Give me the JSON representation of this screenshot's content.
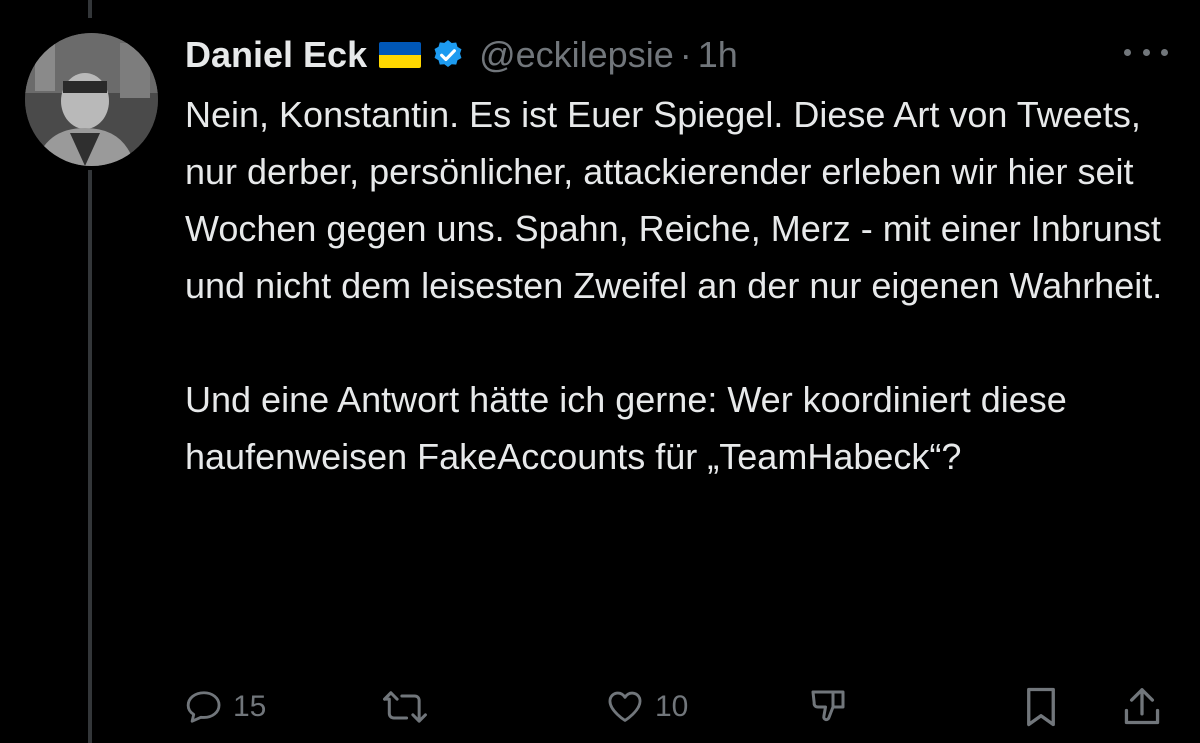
{
  "tweet": {
    "author_name": "Daniel Eck",
    "handle": "@eckilepsie",
    "separator": "·",
    "time": "1h",
    "body_paragraph_1": "Nein, Konstantin. Es ist Euer Spiegel. Diese Art von Tweets, nur derber, persönlicher, attackierender erleben wir hier seit Wochen gegen uns. Spahn, Reiche, Merz - mit einer Inbrunst und nicht dem leisesten Zweifel an der nur eigenen Wahrheit.",
    "body_paragraph_2": "Und eine Antwort hätte ich gerne: Wer koordiniert diese haufenweisen FakeAccounts für „TeamHabeck“?"
  },
  "actions": {
    "reply_count": "15",
    "like_count": "10"
  },
  "icons": {
    "avatar": "avatar",
    "flag": "ukraine-flag-icon",
    "verified": "verified-badge-icon",
    "more": "more-options-icon",
    "reply": "reply-icon",
    "retweet": "retweet-icon",
    "like": "like-icon",
    "dislike": "dislike-icon",
    "bookmark": "bookmark-icon",
    "share": "share-icon"
  },
  "colors": {
    "background": "#000000",
    "text": "#e7e9ea",
    "muted": "#71767b",
    "verified": "#1d9bf0",
    "flag_blue": "#0057b7",
    "flag_yellow": "#ffd700"
  }
}
